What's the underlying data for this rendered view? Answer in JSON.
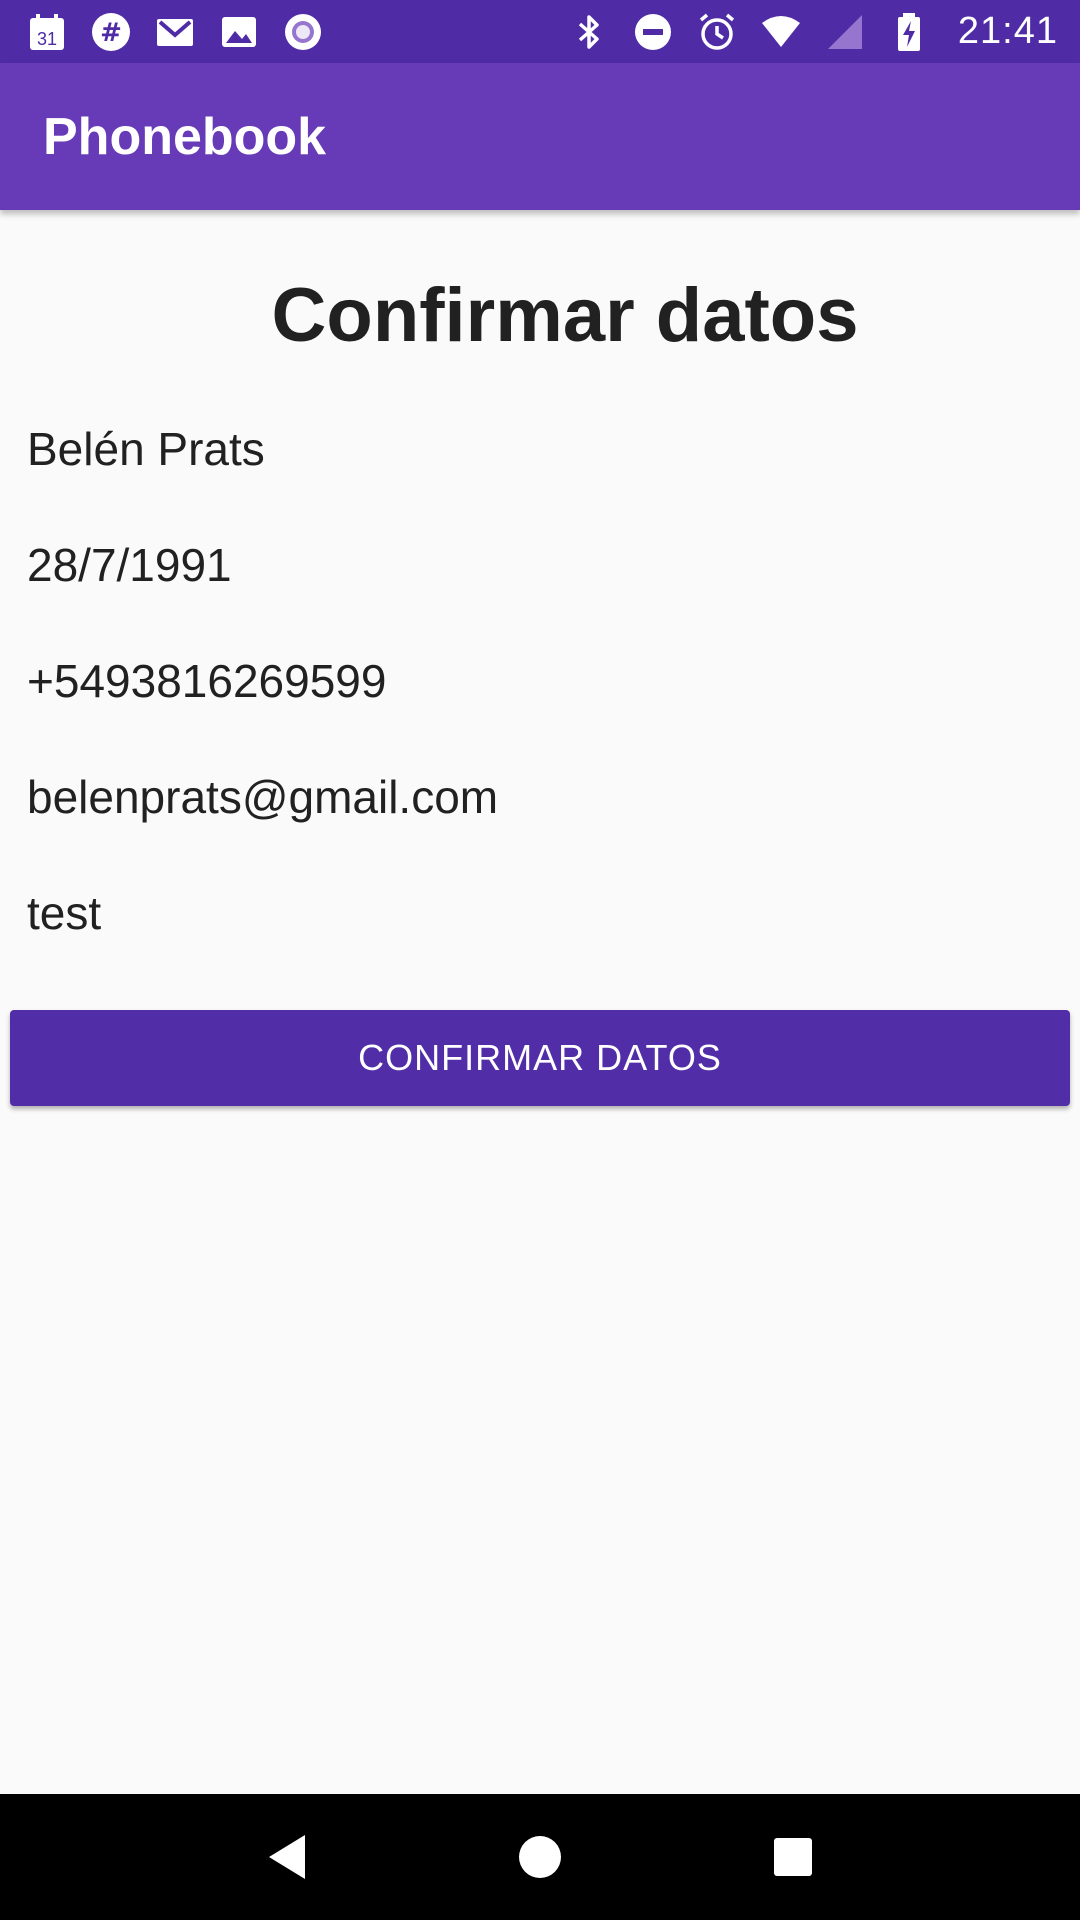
{
  "status_bar": {
    "left_icons": [
      "calendar-icon",
      "slack-icon",
      "gmail-icon",
      "photos-icon",
      "record-icon"
    ],
    "right_icons": [
      "bluetooth-icon",
      "do-not-disturb-icon",
      "alarm-icon",
      "wifi-icon",
      "signal-icon",
      "battery-icon"
    ],
    "calendar_day": "31",
    "time": "21:41"
  },
  "app_bar": {
    "title": "Phonebook"
  },
  "main": {
    "heading": "Confirmar datos",
    "fields": {
      "name": "Belén Prats",
      "birthdate": "28/7/1991",
      "phone": "+5493816269599",
      "email": "belenprats@gmail.com",
      "notes": "test"
    },
    "confirm_button_label": "CONFIRMAR DATOS"
  },
  "nav_bar": {
    "icons": [
      "back-icon",
      "home-icon",
      "recents-icon"
    ]
  },
  "colors": {
    "status_bar": "#4f2ca6",
    "app_bar": "#673ab7",
    "button": "#512da8",
    "background": "#fafafa"
  }
}
